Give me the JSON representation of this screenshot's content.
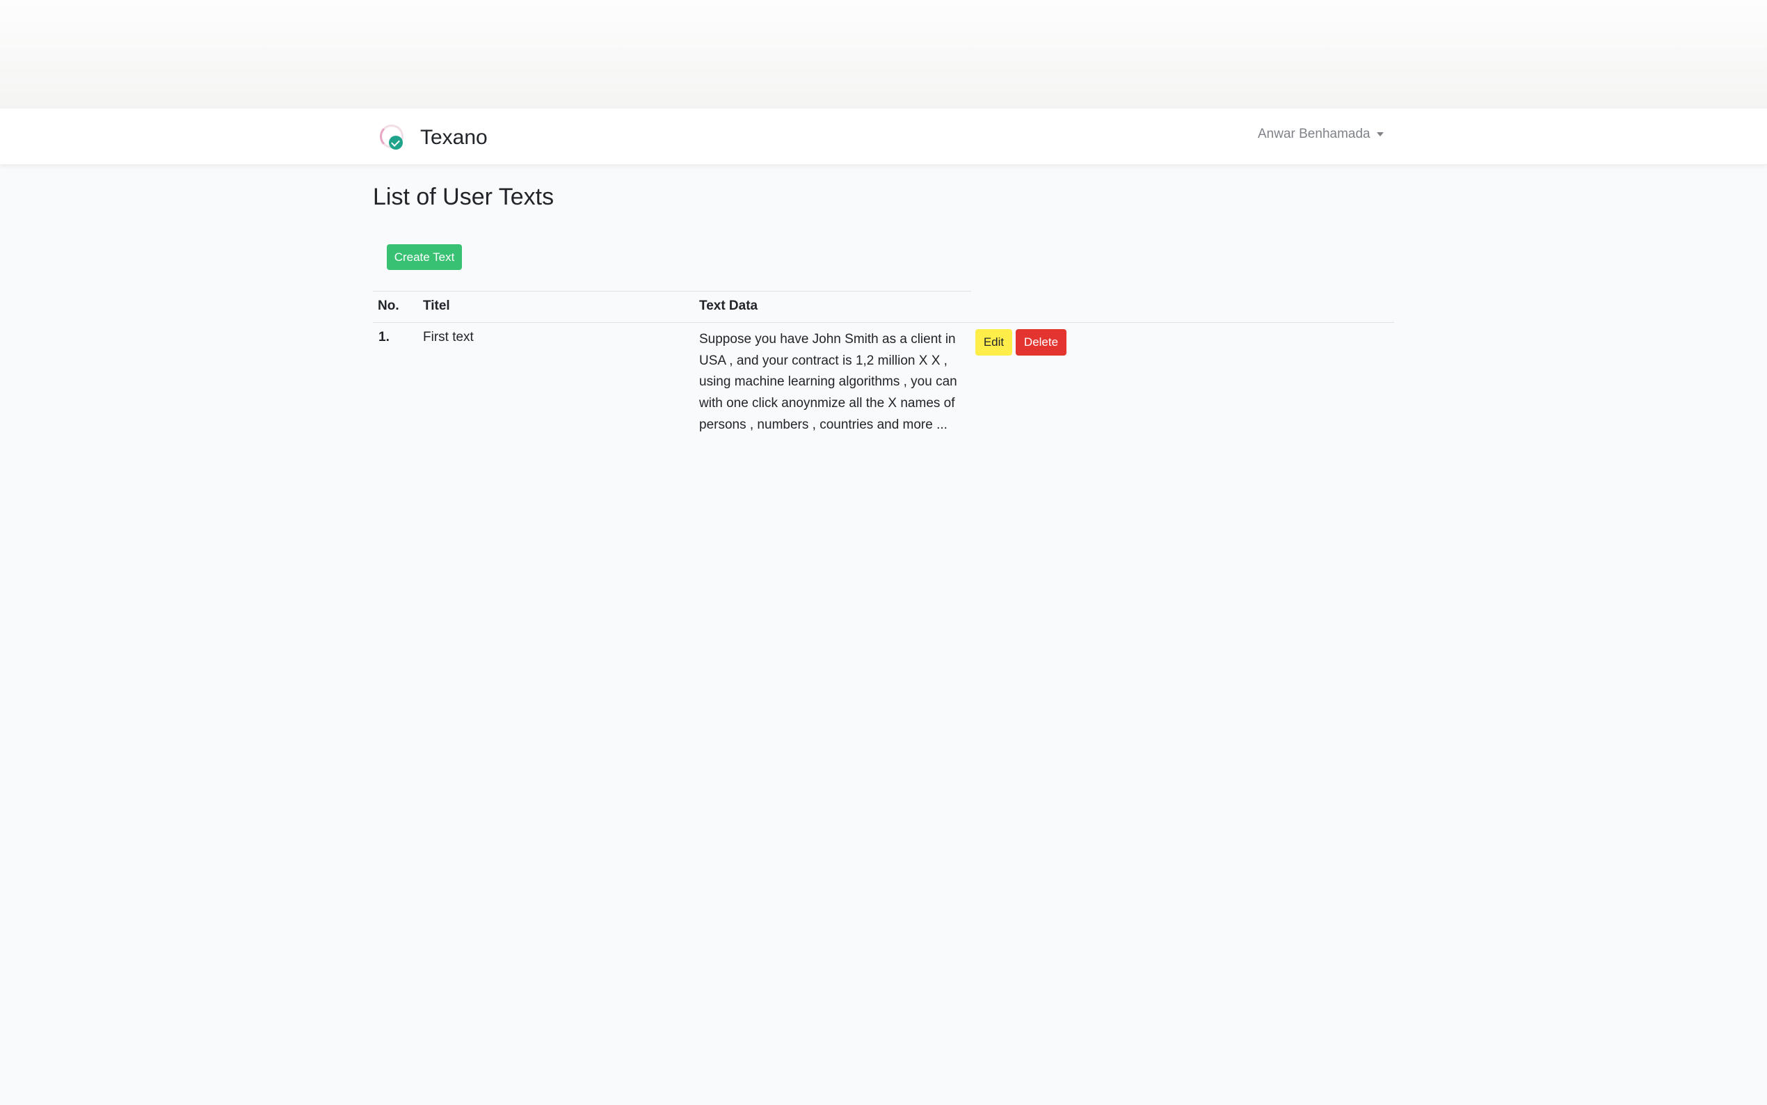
{
  "navbar": {
    "brand": "Texano",
    "user_name": "Anwar Benhamada"
  },
  "page": {
    "title": "List of User Texts",
    "create_button_label": "Create Text"
  },
  "table": {
    "headers": [
      "No.",
      "Titel",
      "Text Data"
    ],
    "rows": [
      {
        "number": "1.",
        "title": "First text",
        "text": "Suppose you have John Smith as a client in USA , and your contract is 1,2 million X X , using machine learning algorithms , you can with one click anoynmize all the X names of persons , numbers , countries and more ...",
        "edit_label": "Edit",
        "delete_label": "Delete"
      }
    ]
  },
  "colors": {
    "success": "#38c172",
    "warning": "#ffed4a",
    "danger": "#e3342f",
    "logo_check": "#1fa38a"
  },
  "icons": {
    "logo": "texano-logo-icon",
    "user_menu": "caret-down-icon"
  }
}
